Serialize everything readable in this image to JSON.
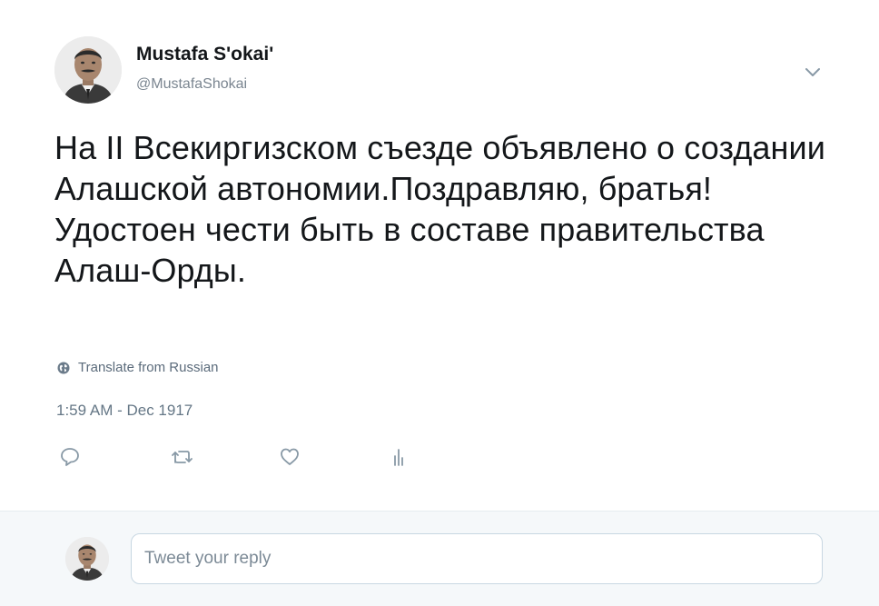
{
  "tweet": {
    "display_name": "Mustafa S'okai'",
    "handle": "@MustafaShokai",
    "text": "На II Всекиргизском съезде объявлено о создании Алашской автономии.Поздравляю, братья!Удостоен чести быть в составе правительства Алаш-Орды.",
    "translate_label": "Translate from Russian",
    "timestamp": "1:59 AM - Dec 1917"
  },
  "icons": {
    "menu": "chevron-down-icon",
    "translate": "globe-icon",
    "reply": "speech-bubble-icon",
    "retweet": "retweet-icon",
    "like": "heart-icon",
    "analytics": "bar-chart-icon"
  },
  "reply_box": {
    "placeholder": "Tweet your reply"
  },
  "colors": {
    "text": "#14171a",
    "secondary": "#657786",
    "icon": "#8899a6",
    "reply_bar_bg": "#f5f8fa",
    "input_border": "#c8d7e2"
  }
}
